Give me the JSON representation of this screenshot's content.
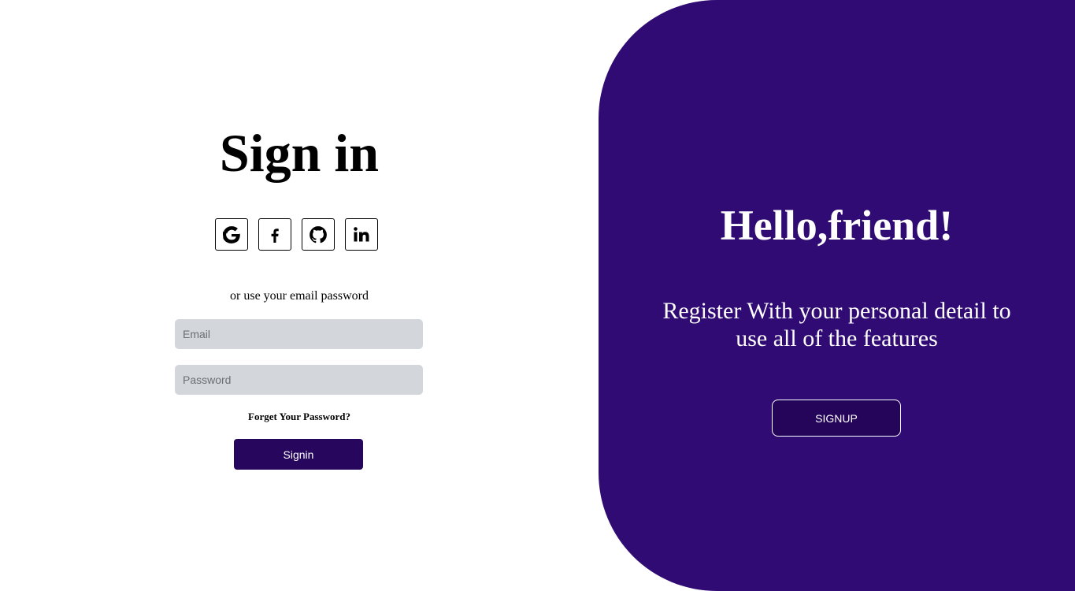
{
  "signin": {
    "title": "Sign in",
    "social": [
      {
        "name": "google",
        "icon": "google-icon"
      },
      {
        "name": "facebook",
        "icon": "facebook-icon"
      },
      {
        "name": "github",
        "icon": "github-icon"
      },
      {
        "name": "linkedin",
        "icon": "linkedin-icon"
      }
    ],
    "alt_text": "or use your email password",
    "email_placeholder": "Email",
    "password_placeholder": "Password",
    "forgot_label": "Forget Your Password?",
    "button_label": "Signin"
  },
  "overlay": {
    "title": "Hello,friend!",
    "text": "Register With your personal detail to use all of the features",
    "button_label": "SIGNUP"
  },
  "colors": {
    "panel_bg": "#2f0b73",
    "button_bg": "#27065e",
    "input_bg": "#d3d6db"
  }
}
